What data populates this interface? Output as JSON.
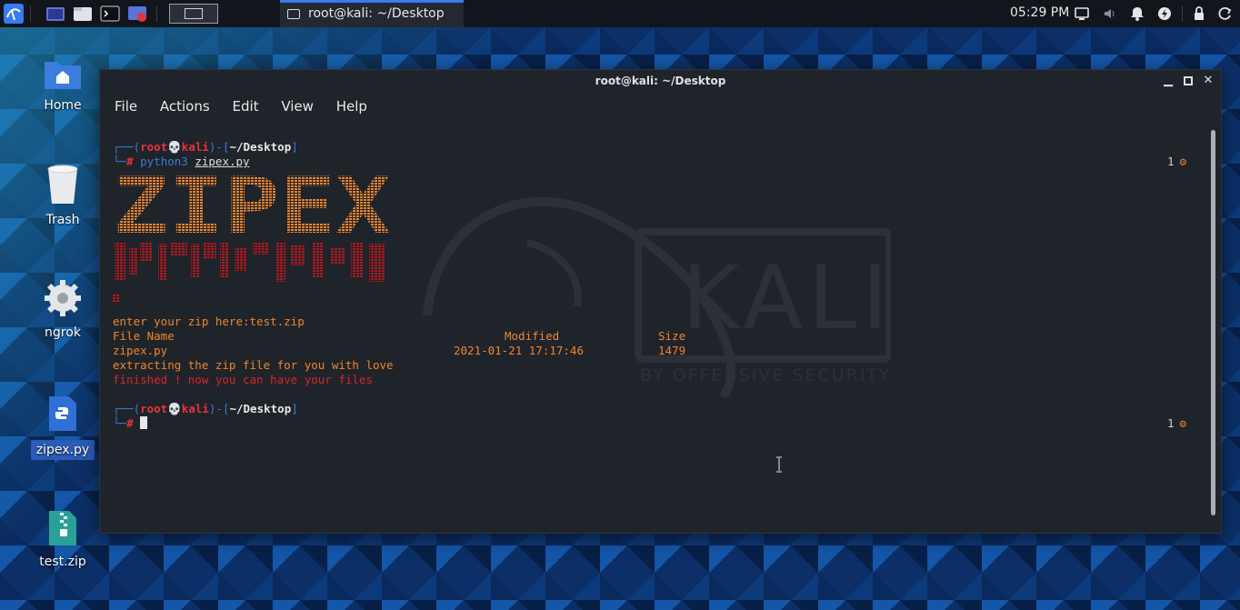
{
  "panel": {
    "task_title": "root@kali: ~/Desktop",
    "clock": "05:29 PM"
  },
  "desktop": {
    "icons": [
      {
        "label": "Home",
        "icon": "folder-home-icon"
      },
      {
        "label": "Trash",
        "icon": "trash-icon"
      },
      {
        "label": "ngrok",
        "icon": "gear-icon"
      },
      {
        "label": "zipex.py",
        "icon": "python-file-icon"
      },
      {
        "label": "test.zip",
        "icon": "zip-file-icon"
      }
    ]
  },
  "terminal": {
    "title": "root@kali: ~/Desktop",
    "menu": [
      "File",
      "Actions",
      "Edit",
      "View",
      "Help"
    ],
    "prompt": {
      "user": "root",
      "skull": "💀",
      "host": "kali",
      "path": "~/Desktop",
      "hash": "#"
    },
    "command": "python3",
    "command_arg": "zipex.py",
    "banner_text": "ZIPEX",
    "output": {
      "enter_zip": "enter your zip here:test.zip",
      "col_file": "File Name",
      "col_modified": "Modified",
      "col_size": "Size",
      "file_name": "zipex.py",
      "file_modified": "2021-01-21 17:17:46",
      "file_size": "1479",
      "extracting": "extracting the zip file for you with love",
      "finished": "finished ! now you can have your files"
    },
    "job_count_1": "1",
    "job_count_2": "1",
    "watermark_main": "KALI",
    "watermark_sub": "BY OFFENSIVE SECURITY"
  },
  "colors": {
    "accent": "#367bf0",
    "prompt_red": "#e6343c",
    "prompt_blue": "#3a7bd5",
    "output_orange": "#f0862b",
    "finished_red": "#d32a2a"
  }
}
